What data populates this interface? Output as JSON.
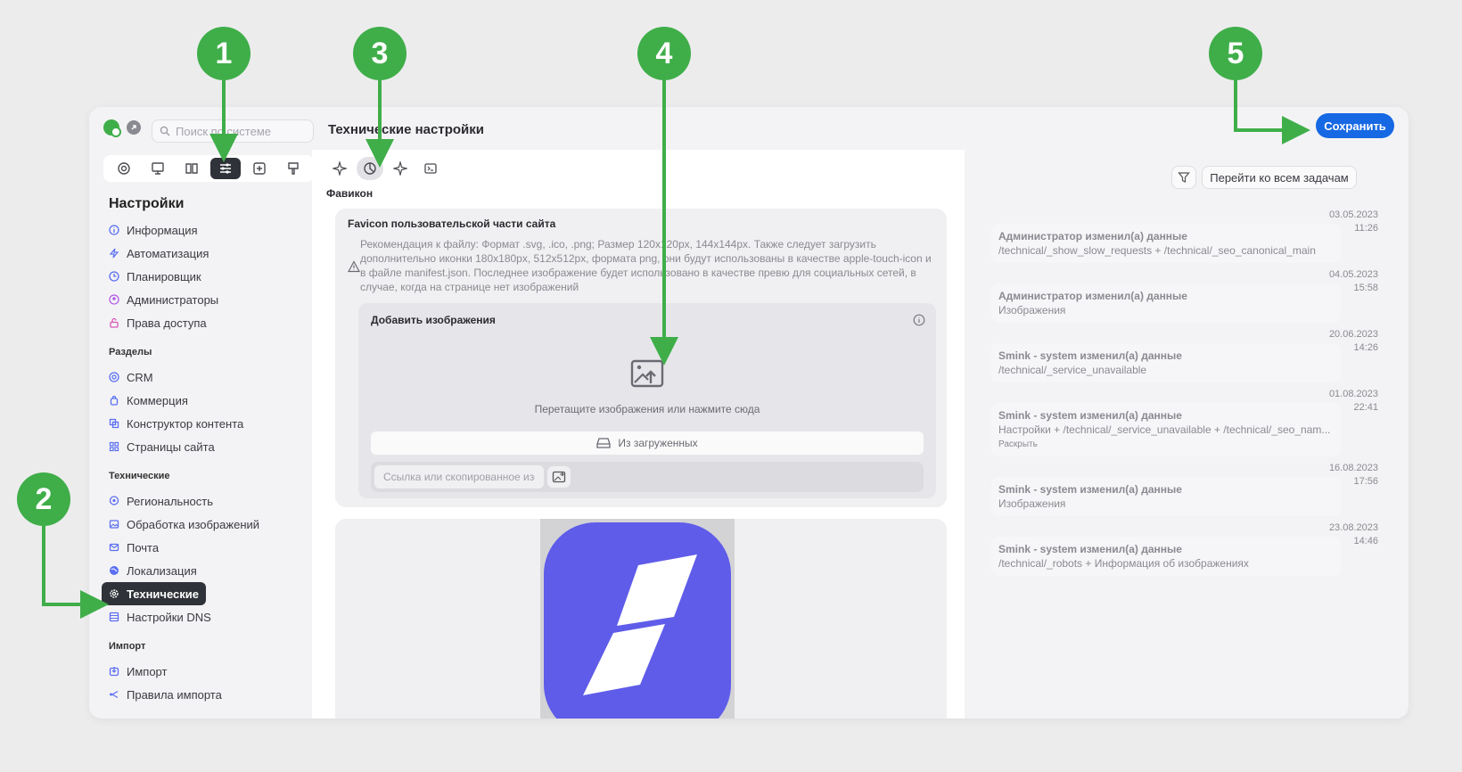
{
  "search": {
    "placeholder": "Поиск по системе"
  },
  "header": {
    "title": "Технические настройки",
    "save_label": "Сохранить"
  },
  "sidebar": {
    "title": "Настройки",
    "main_items": [
      {
        "label": "Информация",
        "icon": "info-icon"
      },
      {
        "label": "Автоматизация",
        "icon": "automation-icon"
      },
      {
        "label": "Планировщик",
        "icon": "clock-icon"
      },
      {
        "label": "Администраторы",
        "icon": "admin-icon"
      },
      {
        "label": "Права доступа",
        "icon": "lock-icon"
      }
    ],
    "sections": [
      {
        "title": "Разделы",
        "items": [
          {
            "label": "CRM",
            "icon": "crm-icon"
          },
          {
            "label": "Коммерция",
            "icon": "shopping-bag-icon"
          },
          {
            "label": "Конструктор контента",
            "icon": "builder-icon"
          },
          {
            "label": "Страницы сайта",
            "icon": "pages-icon"
          }
        ]
      },
      {
        "title": "Технические",
        "items": [
          {
            "label": "Региональность",
            "icon": "location-icon"
          },
          {
            "label": "Обработка изображений",
            "icon": "image-icon"
          },
          {
            "label": "Почта",
            "icon": "mail-icon"
          },
          {
            "label": "Локализация",
            "icon": "globe-icon"
          },
          {
            "label": "Технические",
            "icon": "gear-icon",
            "active": true
          },
          {
            "label": "Настройки DNS",
            "icon": "dns-icon"
          }
        ]
      },
      {
        "title": "Импорт",
        "items": [
          {
            "label": "Импорт",
            "icon": "import-icon"
          },
          {
            "label": "Правила импорта",
            "icon": "rules-icon"
          }
        ]
      }
    ]
  },
  "content": {
    "section_label": "Фавикон",
    "card_title": "Favicon пользовательской части сайта",
    "card_description": "Рекомендация к файлу: Формат .svg, .ico, .png; Размер 120x120px, 144x144px. Также следует загрузить дополнительно иконки 180x180px, 512x512px, формата png, они будут использованы в качестве apple-touch-icon и в файле manifest.json. Последнее изображение будет использовано в качестве превю для социальных сетей, в случае, когда на странице нет изображений",
    "upload_title": "Добавить изображения",
    "upload_hint": "Перетащите изображения или нажмите сюда",
    "from_loaded_label": "Из загруженных",
    "link_placeholder": "Ссылка или скопированное изображение"
  },
  "activity": {
    "all_tasks_label": "Перейти ко всем задачам",
    "entries": [
      {
        "date": "03.05.2023",
        "time": "11:26",
        "author": "Администратор изменил(а) данные",
        "detail": "/technical/_show_slow_requests + /technical/_seo_canonical_main"
      },
      {
        "date": "04.05.2023",
        "time": "15:58",
        "author": "Администратор изменил(а) данные",
        "detail": "Изображения"
      },
      {
        "date": "20.06.2023",
        "time": "14:26",
        "author": "Smink - system изменил(а) данные",
        "detail": "/technical/_service_unavailable"
      },
      {
        "date": "01.08.2023",
        "time": "22:41",
        "author": "Smink - system изменил(а) данные",
        "detail": "Настройки + /technical/_service_unavailable + /technical/_seo_nam...",
        "expand": "Раскрыть"
      },
      {
        "date": "16.08.2023",
        "time": "17:56",
        "author": "Smink - system изменил(а) данные",
        "detail": "Изображения"
      },
      {
        "date": "23.08.2023",
        "time": "14:46",
        "author": "Smink - system изменил(а) данные",
        "detail": "/technical/_robots + Информация об изображениях"
      }
    ]
  },
  "annotations": [
    "1",
    "2",
    "3",
    "4",
    "5"
  ],
  "colors": {
    "accent": "#1668e3",
    "annotation": "#3fae49",
    "brand": "#5a55e8"
  }
}
